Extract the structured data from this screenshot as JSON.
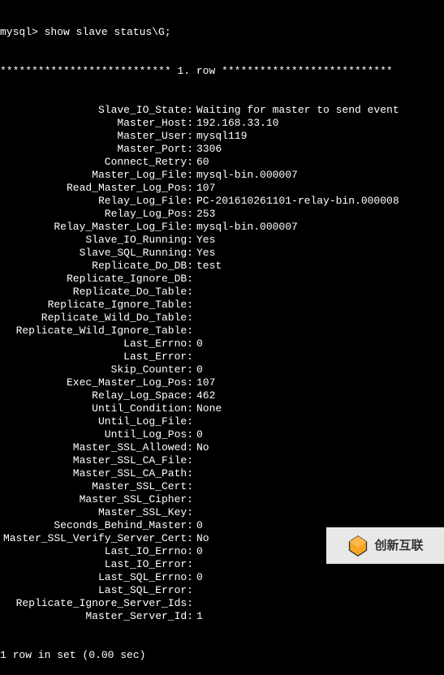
{
  "prompt": "mysql> show slave status\\G;",
  "row_separator": "*************************** 1. row ***************************",
  "fields": [
    {
      "label": "Slave_IO_State:",
      "value": "Waiting for master to send event"
    },
    {
      "label": "Master_Host:",
      "value": "192.168.33.10"
    },
    {
      "label": "Master_User:",
      "value": "mysql119"
    },
    {
      "label": "Master_Port:",
      "value": "3306"
    },
    {
      "label": "Connect_Retry:",
      "value": "60"
    },
    {
      "label": "Master_Log_File:",
      "value": "mysql-bin.000007"
    },
    {
      "label": "Read_Master_Log_Pos:",
      "value": "107"
    },
    {
      "label": "Relay_Log_File:",
      "value": "PC-201610261101-relay-bin.000008"
    },
    {
      "label": "Relay_Log_Pos:",
      "value": "253"
    },
    {
      "label": "Relay_Master_Log_File:",
      "value": "mysql-bin.000007"
    },
    {
      "label": "Slave_IO_Running:",
      "value": "Yes"
    },
    {
      "label": "Slave_SQL_Running:",
      "value": "Yes"
    },
    {
      "label": "Replicate_Do_DB:",
      "value": "test"
    },
    {
      "label": "Replicate_Ignore_DB:",
      "value": ""
    },
    {
      "label": "Replicate_Do_Table:",
      "value": ""
    },
    {
      "label": "Replicate_Ignore_Table:",
      "value": ""
    },
    {
      "label": "Replicate_Wild_Do_Table:",
      "value": ""
    },
    {
      "label": "Replicate_Wild_Ignore_Table:",
      "value": ""
    },
    {
      "label": "Last_Errno:",
      "value": "0"
    },
    {
      "label": "Last_Error:",
      "value": ""
    },
    {
      "label": "Skip_Counter:",
      "value": "0"
    },
    {
      "label": "Exec_Master_Log_Pos:",
      "value": "107"
    },
    {
      "label": "Relay_Log_Space:",
      "value": "462"
    },
    {
      "label": "Until_Condition:",
      "value": "None"
    },
    {
      "label": "Until_Log_File:",
      "value": ""
    },
    {
      "label": "Until_Log_Pos:",
      "value": "0"
    },
    {
      "label": "Master_SSL_Allowed:",
      "value": "No"
    },
    {
      "label": "Master_SSL_CA_File:",
      "value": ""
    },
    {
      "label": "Master_SSL_CA_Path:",
      "value": ""
    },
    {
      "label": "Master_SSL_Cert:",
      "value": ""
    },
    {
      "label": "Master_SSL_Cipher:",
      "value": ""
    },
    {
      "label": "Master_SSL_Key:",
      "value": ""
    },
    {
      "label": "Seconds_Behind_Master:",
      "value": "0"
    },
    {
      "label": "Master_SSL_Verify_Server_Cert:",
      "value": "No"
    },
    {
      "label": "Last_IO_Errno:",
      "value": "0"
    },
    {
      "label": "Last_IO_Error:",
      "value": ""
    },
    {
      "label": "Last_SQL_Errno:",
      "value": "0"
    },
    {
      "label": "Last_SQL_Error:",
      "value": ""
    },
    {
      "label": "Replicate_Ignore_Server_Ids:",
      "value": ""
    },
    {
      "label": "Master_Server_Id:",
      "value": "1"
    }
  ],
  "footer": "1 row in set (0.00 sec)",
  "watermark_text": "创新互联"
}
